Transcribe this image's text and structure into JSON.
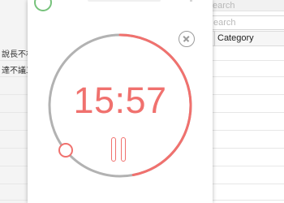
{
  "background_app": {
    "rows": [
      {
        "text": "說長不相"
      },
      {
        "text": "達不議工"
      }
    ],
    "search_top_placeholder": "earch",
    "search_placeholder": "earch",
    "category_header": "Category"
  },
  "timer": {
    "time": "15:57",
    "progress_elapsed": 0.53,
    "colors": {
      "accent": "#f0716e",
      "track": "#b2b2b2",
      "close": "#9c9c9c"
    },
    "close_icon": "close-icon",
    "pause_icon": "pause-icon"
  }
}
